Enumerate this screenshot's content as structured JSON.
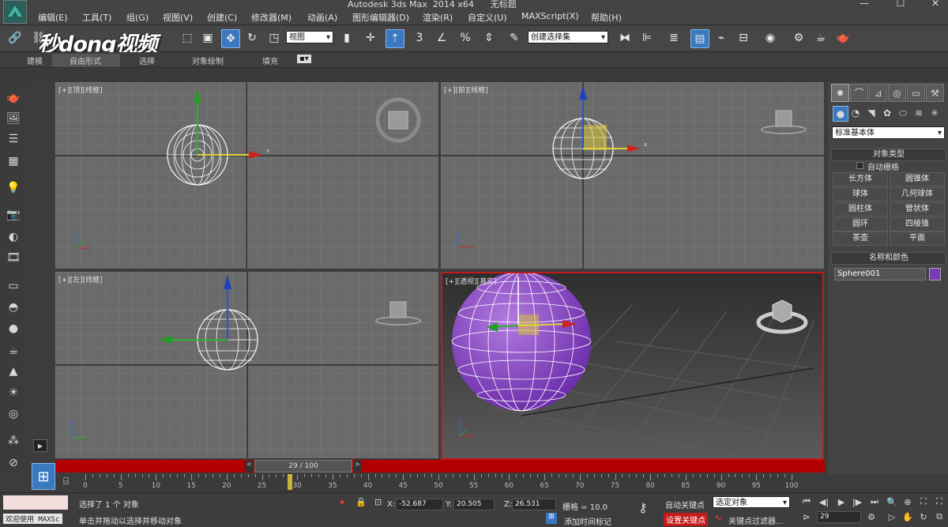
{
  "window": {
    "title": "Autodesk 3ds Max  2014 x64      无标题"
  },
  "menubar": {
    "items": [
      "编辑(E)",
      "工具(T)",
      "组(G)",
      "视图(V)",
      "创建(C)",
      "修改器(M)",
      "动画(A)",
      "图形编辑器(D)",
      "渲染(R)",
      "自定义(U)",
      "MAXScript(X)",
      "帮助(H)"
    ]
  },
  "toolbar": {
    "view_dropdown": "视图",
    "selection_set": "创建选择集",
    "snap_3": "3",
    "snap_angle": "∠",
    "snap_percent": "%",
    "brand_watermark": "秒dong视频"
  },
  "ribbon": {
    "tabs": [
      "建模",
      "自由形式",
      "选择",
      "对象绘制",
      "填充"
    ]
  },
  "viewports": [
    {
      "label": "[+][顶][线框]"
    },
    {
      "label": "[+][前][线框]"
    },
    {
      "label": "[+][左][线框]"
    },
    {
      "label": "[+][透视][真实]"
    }
  ],
  "command_panel": {
    "dropdown": "标准基本体",
    "object_type_header": "对象类型",
    "autogrid": "自动栅格",
    "buttons": [
      "长方体",
      "圆锥体",
      "球体",
      "几何球体",
      "圆柱体",
      "管状体",
      "圆环",
      "四棱锥",
      "茶壶",
      "平面"
    ],
    "name_color_header": "名称和颜色",
    "object_name": "Sphere001",
    "object_color": "#7a3bb8"
  },
  "time_slider": {
    "label": "29 / 100",
    "current_frame": 29,
    "max_frame": 100
  },
  "trackbar": {
    "ticks": [
      0,
      5,
      10,
      15,
      20,
      25,
      30,
      35,
      40,
      45,
      50,
      55,
      60,
      65,
      70,
      75,
      80,
      85,
      90,
      95,
      100
    ]
  },
  "status": {
    "maxscript_listener": "欢迎使用 MAXSc",
    "selection_msg": "选择了 1 个 对象",
    "prompt_msg": "单击并拖动以选择并移动对象",
    "x_label": "X:",
    "x_value": "-52.687",
    "y_label": "Y:",
    "y_value": "20.505",
    "z_label": "Z:",
    "z_value": "26.531",
    "grid": "栅格 = 10.0",
    "add_time_tag": "添加时间标记",
    "auto_key": "自动关键点",
    "set_key": "设置关键点",
    "key_filter": "关键点过滤器...",
    "selected_dropdown": "选定对象",
    "frame_value": "29"
  },
  "colors": {
    "viewport_active_border": "#c41a1a",
    "sphere_fill": "#7f3cc0",
    "timeline_red": "#b00000",
    "accent_blue": "#3a78c0"
  }
}
